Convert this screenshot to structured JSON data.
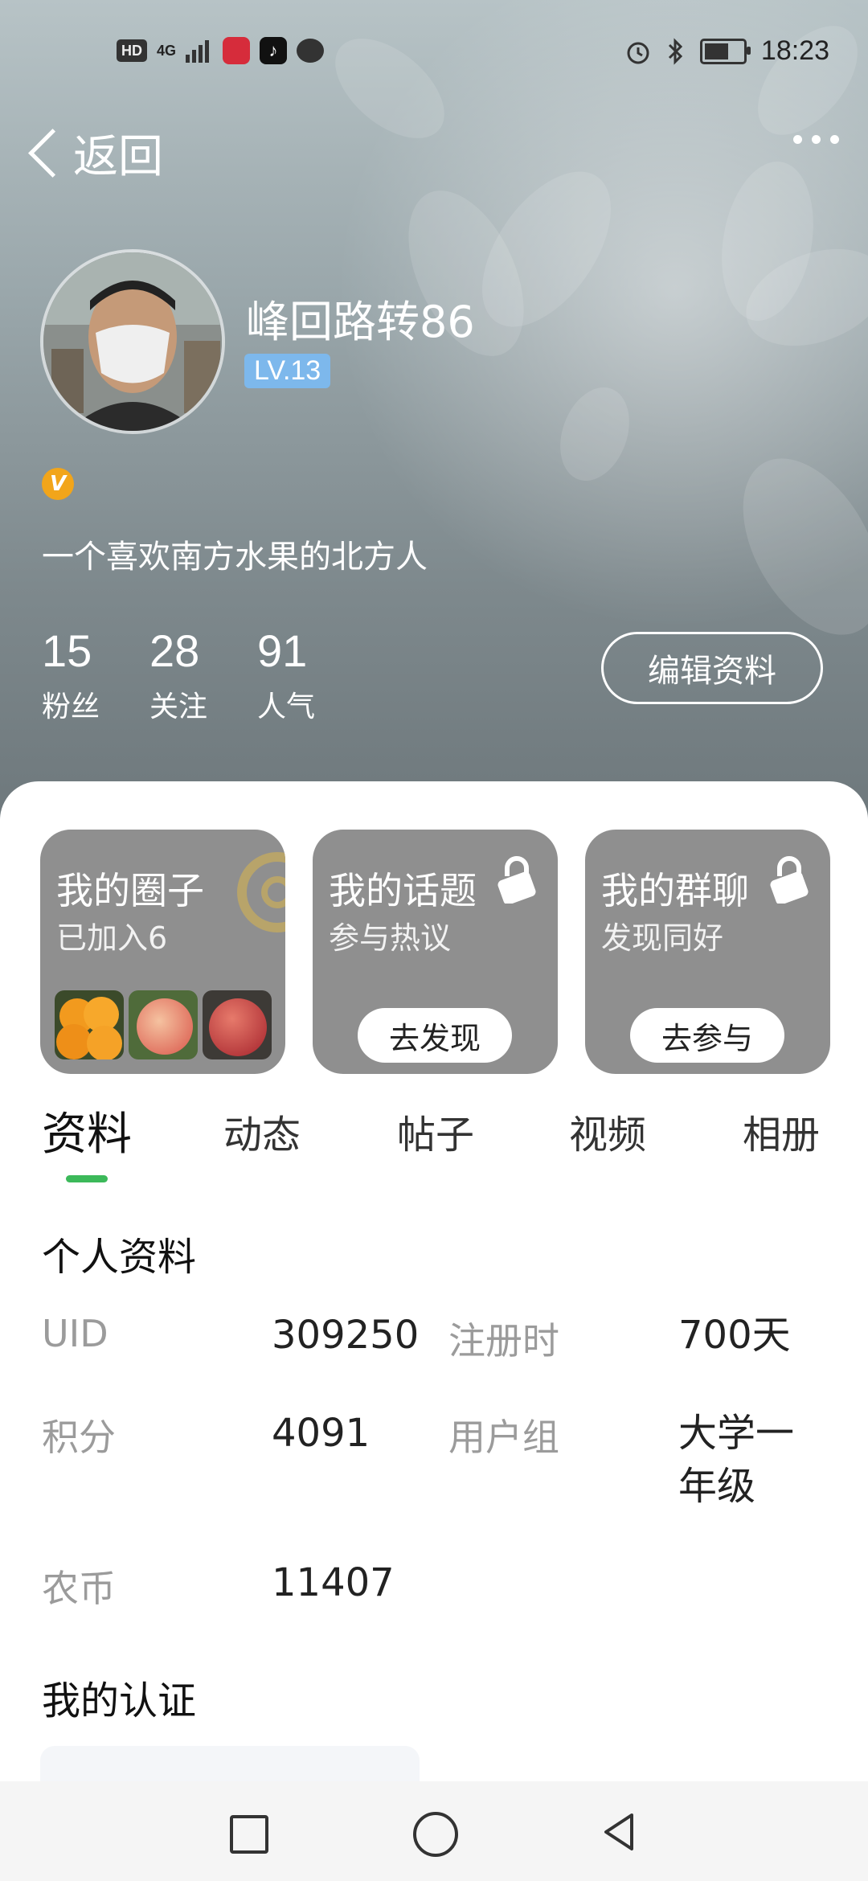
{
  "status_bar": {
    "hd": "HD",
    "network": "4G",
    "time": "18:23"
  },
  "top_bar": {
    "back_label": "返回"
  },
  "profile": {
    "username": "峰回路转86",
    "level": "LV.13",
    "verified_badge": "V",
    "bio": "一个喜欢南方水果的北方人",
    "stats": [
      {
        "value": "15",
        "label": "粉丝"
      },
      {
        "value": "28",
        "label": "关注"
      },
      {
        "value": "91",
        "label": "人气"
      }
    ],
    "edit_label": "编辑资料"
  },
  "cards": [
    {
      "title": "我的圈子",
      "subtitle": "已加入6"
    },
    {
      "title": "我的话题",
      "subtitle": "参与热议",
      "button": "去发现"
    },
    {
      "title": "我的群聊",
      "subtitle": "发现同好",
      "button": "去参与"
    }
  ],
  "tabs": [
    "资料",
    "动态",
    "帖子",
    "视频",
    "相册"
  ],
  "active_tab": "资料",
  "personal_info": {
    "title": "个人资料",
    "uid_label": "UID",
    "uid_value": "309250",
    "reg_label": "注册时",
    "reg_value": "700天",
    "points_label": "积分",
    "points_value": "4091",
    "group_label": "用户组",
    "group_value_line1": "大学一",
    "group_value_line2": "年级",
    "coins_label": "农币",
    "coins_value": "11407"
  },
  "certification": {
    "title": "我的认证"
  },
  "colors": {
    "accent_green": "#3cb95a",
    "level_badge": "#7db8ec",
    "verified_orange": "#f2a51a",
    "card_gray": "#8f8f8f"
  },
  "icons": [
    "back-chevron-icon",
    "more-icon",
    "lock-icon",
    "alarm-icon",
    "bluetooth-icon",
    "battery-icon",
    "signal-icon"
  ]
}
